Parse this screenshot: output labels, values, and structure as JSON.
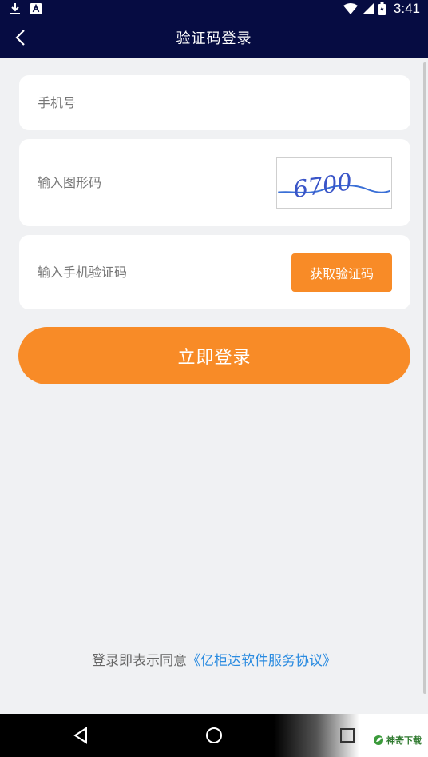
{
  "status_bar": {
    "time": "3:41",
    "icons": [
      "download-icon",
      "notification-a-icon",
      "wifi-icon",
      "signal-icon",
      "battery-icon"
    ]
  },
  "header": {
    "title": "验证码登录",
    "back_icon": "back-chevron-icon"
  },
  "form": {
    "phone_placeholder": "手机号",
    "captcha_placeholder": "输入图形码",
    "captcha_image_text": "6700",
    "sms_placeholder": "输入手机验证码",
    "get_code_label": "获取验证码"
  },
  "login_button": "立即登录",
  "agreement": {
    "prefix": "登录即表示同意",
    "link": "《亿柜达软件服务协议》"
  },
  "nav_bar": {
    "icons": [
      "back-triangle-icon",
      "home-circle-icon",
      "recents-square-icon"
    ]
  },
  "watermark": "神奇下载",
  "colors": {
    "header_bg": "#060c42",
    "accent": "#f88b27",
    "link": "#2a8be0",
    "page_bg": "#f0f1f3"
  }
}
